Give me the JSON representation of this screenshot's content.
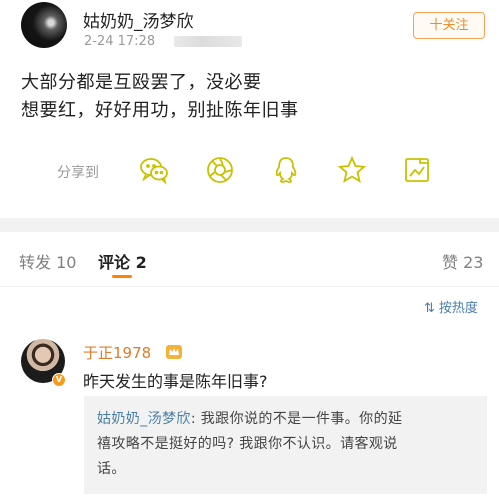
{
  "post": {
    "author": "姑奶奶_汤梦欣",
    "time": "2-24 17:28",
    "follow_label": "十关注",
    "content_lines": [
      "大部分都是互殴罢了，没必要",
      "想要红，好好用功，别扯陈年旧事"
    ]
  },
  "share": {
    "label": "分享到",
    "icons": [
      "wechat-icon",
      "moments-icon",
      "qq-icon",
      "favorite-icon",
      "screenshot-icon"
    ],
    "icon_color": "#c8c200"
  },
  "tabs": {
    "repost": "转发 10",
    "comments": "评论 2",
    "likes": "赞 23",
    "accent_color": "#ff8200"
  },
  "sort": {
    "glyph": "⇅",
    "label": "按热度"
  },
  "comment": {
    "author": "于正1978",
    "text": "昨天发生的事是陈年旧事?",
    "badge": "V",
    "reply": {
      "author": "姑奶奶_汤梦欣",
      "line1_rest": ": 我跟你说的不是一件事。你的延",
      "line2": "禧攻略不是挺好的吗? 我跟你不认识。请客观说",
      "line3": "话。"
    }
  }
}
